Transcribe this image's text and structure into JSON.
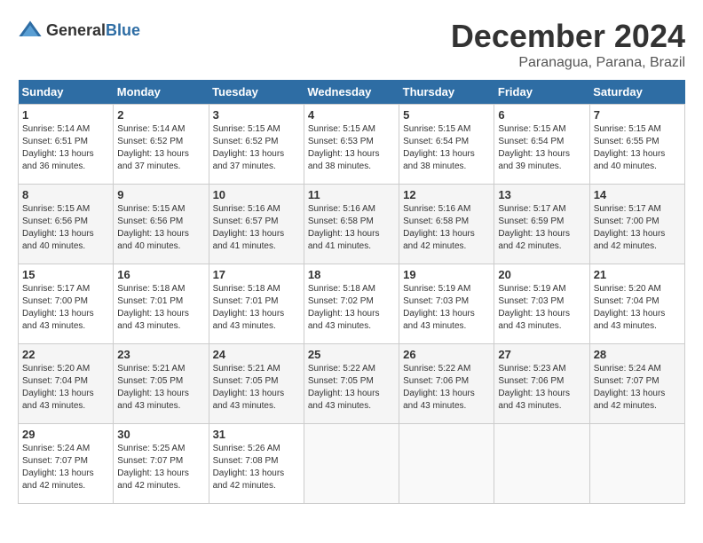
{
  "header": {
    "logo": {
      "text_general": "General",
      "text_blue": "Blue"
    },
    "month": "December 2024",
    "location": "Paranagua, Parana, Brazil"
  },
  "days_of_week": [
    "Sunday",
    "Monday",
    "Tuesday",
    "Wednesday",
    "Thursday",
    "Friday",
    "Saturday"
  ],
  "weeks": [
    [
      {
        "day": "1",
        "sunrise": "5:14 AM",
        "sunset": "6:51 PM",
        "daylight": "13 hours and 36 minutes."
      },
      {
        "day": "2",
        "sunrise": "5:14 AM",
        "sunset": "6:52 PM",
        "daylight": "13 hours and 37 minutes."
      },
      {
        "day": "3",
        "sunrise": "5:15 AM",
        "sunset": "6:52 PM",
        "daylight": "13 hours and 37 minutes."
      },
      {
        "day": "4",
        "sunrise": "5:15 AM",
        "sunset": "6:53 PM",
        "daylight": "13 hours and 38 minutes."
      },
      {
        "day": "5",
        "sunrise": "5:15 AM",
        "sunset": "6:54 PM",
        "daylight": "13 hours and 38 minutes."
      },
      {
        "day": "6",
        "sunrise": "5:15 AM",
        "sunset": "6:54 PM",
        "daylight": "13 hours and 39 minutes."
      },
      {
        "day": "7",
        "sunrise": "5:15 AM",
        "sunset": "6:55 PM",
        "daylight": "13 hours and 40 minutes."
      }
    ],
    [
      {
        "day": "8",
        "sunrise": "5:15 AM",
        "sunset": "6:56 PM",
        "daylight": "13 hours and 40 minutes."
      },
      {
        "day": "9",
        "sunrise": "5:15 AM",
        "sunset": "6:56 PM",
        "daylight": "13 hours and 40 minutes."
      },
      {
        "day": "10",
        "sunrise": "5:16 AM",
        "sunset": "6:57 PM",
        "daylight": "13 hours and 41 minutes."
      },
      {
        "day": "11",
        "sunrise": "5:16 AM",
        "sunset": "6:58 PM",
        "daylight": "13 hours and 41 minutes."
      },
      {
        "day": "12",
        "sunrise": "5:16 AM",
        "sunset": "6:58 PM",
        "daylight": "13 hours and 42 minutes."
      },
      {
        "day": "13",
        "sunrise": "5:17 AM",
        "sunset": "6:59 PM",
        "daylight": "13 hours and 42 minutes."
      },
      {
        "day": "14",
        "sunrise": "5:17 AM",
        "sunset": "7:00 PM",
        "daylight": "13 hours and 42 minutes."
      }
    ],
    [
      {
        "day": "15",
        "sunrise": "5:17 AM",
        "sunset": "7:00 PM",
        "daylight": "13 hours and 43 minutes."
      },
      {
        "day": "16",
        "sunrise": "5:18 AM",
        "sunset": "7:01 PM",
        "daylight": "13 hours and 43 minutes."
      },
      {
        "day": "17",
        "sunrise": "5:18 AM",
        "sunset": "7:01 PM",
        "daylight": "13 hours and 43 minutes."
      },
      {
        "day": "18",
        "sunrise": "5:18 AM",
        "sunset": "7:02 PM",
        "daylight": "13 hours and 43 minutes."
      },
      {
        "day": "19",
        "sunrise": "5:19 AM",
        "sunset": "7:03 PM",
        "daylight": "13 hours and 43 minutes."
      },
      {
        "day": "20",
        "sunrise": "5:19 AM",
        "sunset": "7:03 PM",
        "daylight": "13 hours and 43 minutes."
      },
      {
        "day": "21",
        "sunrise": "5:20 AM",
        "sunset": "7:04 PM",
        "daylight": "13 hours and 43 minutes."
      }
    ],
    [
      {
        "day": "22",
        "sunrise": "5:20 AM",
        "sunset": "7:04 PM",
        "daylight": "13 hours and 43 minutes."
      },
      {
        "day": "23",
        "sunrise": "5:21 AM",
        "sunset": "7:05 PM",
        "daylight": "13 hours and 43 minutes."
      },
      {
        "day": "24",
        "sunrise": "5:21 AM",
        "sunset": "7:05 PM",
        "daylight": "13 hours and 43 minutes."
      },
      {
        "day": "25",
        "sunrise": "5:22 AM",
        "sunset": "7:05 PM",
        "daylight": "13 hours and 43 minutes."
      },
      {
        "day": "26",
        "sunrise": "5:22 AM",
        "sunset": "7:06 PM",
        "daylight": "13 hours and 43 minutes."
      },
      {
        "day": "27",
        "sunrise": "5:23 AM",
        "sunset": "7:06 PM",
        "daylight": "13 hours and 43 minutes."
      },
      {
        "day": "28",
        "sunrise": "5:24 AM",
        "sunset": "7:07 PM",
        "daylight": "13 hours and 42 minutes."
      }
    ],
    [
      {
        "day": "29",
        "sunrise": "5:24 AM",
        "sunset": "7:07 PM",
        "daylight": "13 hours and 42 minutes."
      },
      {
        "day": "30",
        "sunrise": "5:25 AM",
        "sunset": "7:07 PM",
        "daylight": "13 hours and 42 minutes."
      },
      {
        "day": "31",
        "sunrise": "5:26 AM",
        "sunset": "7:08 PM",
        "daylight": "13 hours and 42 minutes."
      },
      null,
      null,
      null,
      null
    ]
  ]
}
